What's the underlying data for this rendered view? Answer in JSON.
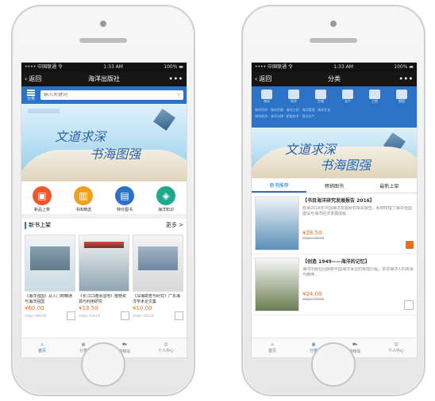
{
  "phone_left": {
    "status": {
      "carrier": "•••• 中国联通 令",
      "time": "1:33 AM",
      "battery": "100% ▬"
    },
    "nav": {
      "back": "返回",
      "title": "海洋出版社",
      "more": "•••"
    },
    "search": {
      "cat_label": "分类",
      "placeholder": "输入关键词"
    },
    "banner": {
      "line1": "文道求深",
      "line2": "书海图强"
    },
    "shortcuts": [
      {
        "label": "新品上架",
        "color": "#f0572d",
        "icon": "▣"
      },
      {
        "label": "书库精选",
        "color": "#f0a020",
        "icon": "▥"
      },
      {
        "label": "特价图书",
        "color": "#2c73c7",
        "icon": "▤"
      },
      {
        "label": "海洋知识",
        "color": "#20a88f",
        "icon": "◈"
      }
    ],
    "section": {
      "title": "新书上架",
      "more": "更多 >"
    },
    "books": [
      {
        "name": "《海洋强国》从入门到精通与海洋强国",
        "price": "¥60.00",
        "old": "市场价 ¥89.00"
      },
      {
        "name": "《长江口滩涂湿地》植物资源与利用研究",
        "price": "¥13.50",
        "old": "市场价 ¥28.00"
      },
      {
        "name": "《深海勘查与研究》广东海洋学术论文集",
        "price": "¥10.00",
        "old": "市场价 ¥28.00"
      }
    ],
    "tabs": [
      {
        "label": "首页",
        "active": true
      },
      {
        "label": "分类",
        "active": false
      },
      {
        "label": "购物车",
        "active": false
      },
      {
        "label": "个人中心",
        "active": false
      }
    ]
  },
  "phone_right": {
    "status": {
      "carrier": "•••• 中国联通 令",
      "time": "1:33 AM",
      "battery": "100% ▬"
    },
    "nav": {
      "back": "返回",
      "title": "分类",
      "more": "•••"
    },
    "categories": [
      "海洋",
      "地学",
      "生物",
      "水产",
      "工程",
      "管理"
    ],
    "cat_rows": [
      "海洋科学 · 海洋资源 · 海洋工程 · 海洋管理 · 海洋文化",
      "海洋经济 · 海洋法律 · 船舶技术 · 渔业水产"
    ],
    "banner": {
      "line1": "文道求深",
      "line2": "书海图强"
    },
    "segments": [
      {
        "label": "新书推荐",
        "on": true
      },
      {
        "label": "畅销图书",
        "on": false
      },
      {
        "label": "最新上架",
        "on": false
      }
    ],
    "items": [
      {
        "title": "【书目海洋研究发展报告 2016】",
        "desc": "收录2016年中国海洋发展研究相关报告，系统梳理了海洋强国建设与海洋经济发展成就…",
        "price": "¥28.50",
        "old": "市场价 ¥38.00"
      },
      {
        "title": "【创造 1949——海洋的记忆】",
        "desc": "海洋出版社回顾新中国海洋事业的辉煌历程，讲述海洋人的故事与精神…",
        "price": "¥24.00",
        "old": "市场价 ¥38.00"
      }
    ],
    "tabs": [
      {
        "label": "首页",
        "active": false
      },
      {
        "label": "分类",
        "active": true
      },
      {
        "label": "购物车",
        "active": false
      },
      {
        "label": "个人中心",
        "active": false
      }
    ]
  }
}
